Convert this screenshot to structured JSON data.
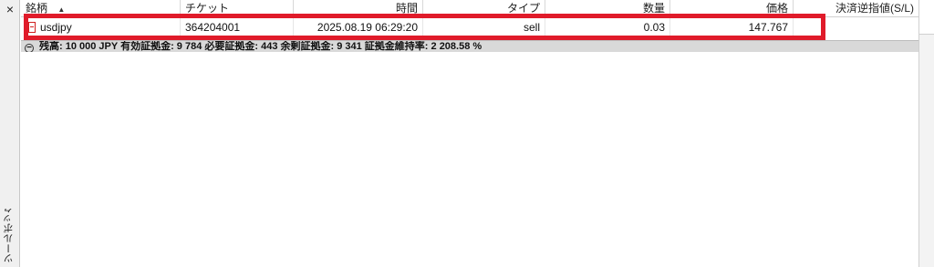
{
  "sidebar": {
    "close_glyph": "×",
    "title": "ツールボックス"
  },
  "table": {
    "columns": [
      "銘柄",
      "チケット",
      "時間",
      "タイプ",
      "数量",
      "価格",
      "決済逆指値(S/L)"
    ],
    "sort_indicator": "▲",
    "row": {
      "symbol": "usdjpy",
      "ticket": "364204001",
      "time": "2025.08.19 06:29:20",
      "type": "sell",
      "volume": "0.03",
      "price": "147.767"
    }
  },
  "summary": {
    "text": "残高: 10 000 JPY  有効証拠金: 9 784  必要証拠金: 443  余剰証拠金: 9 341  証拠金維持率: 2 208.58 %"
  },
  "colors": {
    "highlight": "#e01b2a",
    "sell_icon": "#d02020",
    "summary_bg": "#d9d9d9"
  }
}
